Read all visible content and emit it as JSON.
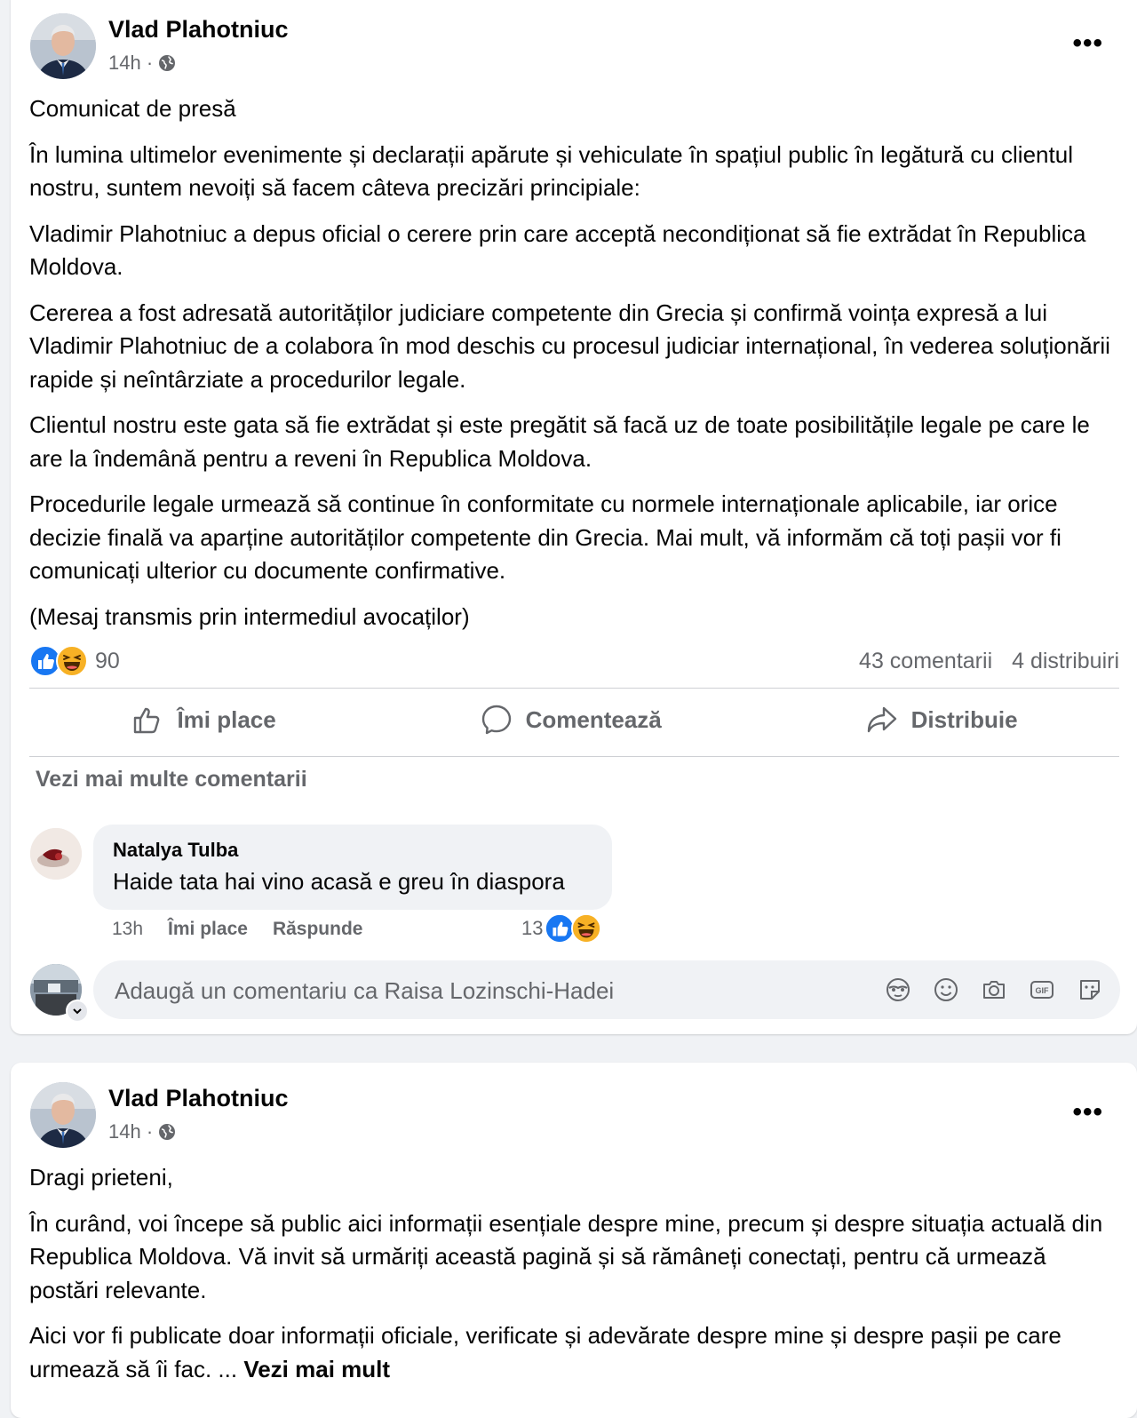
{
  "posts": [
    {
      "author": "Vlad Plahotniuc",
      "time": "14h · ",
      "audience_icon": "globe-icon",
      "more": "•••",
      "paragraphs": [
        "Comunicat de presă",
        "În lumina ultimelor evenimente și declarații apărute și vehiculate în spațiul public în legătură cu clientul nostru, suntem nevoiți să facem câteva precizări principiale:",
        "Vladimir Plahotniuc a depus oficial o cerere prin care acceptă necondiționat să fie extrădat în Republica Moldova.",
        "Cererea a fost adresată autorităților judiciare competente din Grecia și confirmă voința expresă a lui Vladimir Plahotniuc de a colabora în mod deschis cu procesul judiciar internațional, în vederea soluționării rapide și neîntârziate a procedurilor legale.",
        "Clientul nostru este gata să fie extrădat și este pregătit să facă uz de toate posibilitățile legale pe care le are la îndemână pentru a reveni în Republica Moldova.",
        "Procedurile legale urmează să continue în conformitate cu normele internaționale aplicabile, iar orice decizie finală va aparține autorităților competente din Grecia. Mai mult, vă informăm că toți pașii vor fi comunicați ulterior cu documente confirmative.",
        "(Mesaj transmis prin intermediul avocaților)"
      ],
      "reactions_count": "90",
      "comments_count": "43 comentarii",
      "shares_count": "4 distribuiri",
      "actions": {
        "like": "Îmi place",
        "comment": "Comentează",
        "share": "Distribuie"
      },
      "more_comments": "Vezi mai multe comentarii",
      "comment": {
        "name": "Natalya Tulba",
        "text": "Haide tata hai vino acasă e greu în diaspora",
        "time": "13h",
        "like": "Îmi place",
        "reply": "Răspunde",
        "reactions": "13"
      },
      "input_placeholder": "Adaugă un comentariu ca Raisa Lozinschi-Hadei"
    },
    {
      "author": "Vlad Plahotniuc",
      "time": "14h · ",
      "audience_icon": "globe-icon",
      "more": "•••",
      "paragraphs": [
        "Dragi prieteni,",
        "În curând, voi începe să public aici informații esențiale despre mine, precum și despre situația actuală din Republica Moldova. Vă invit să urmăriți această pagină și să rămâneți conectați, pentru că urmează postări relevante.",
        "Aici vor fi publicate doar informații oficiale, verificate și adevărate despre mine și despre pașii pe care urmează să îi fac. ... "
      ],
      "see_more": "Vezi mai mult"
    }
  ],
  "colors": {
    "like_blue": "#1877f2",
    "haha_yellow": "#f7b125",
    "secondary_text": "#65676b"
  }
}
